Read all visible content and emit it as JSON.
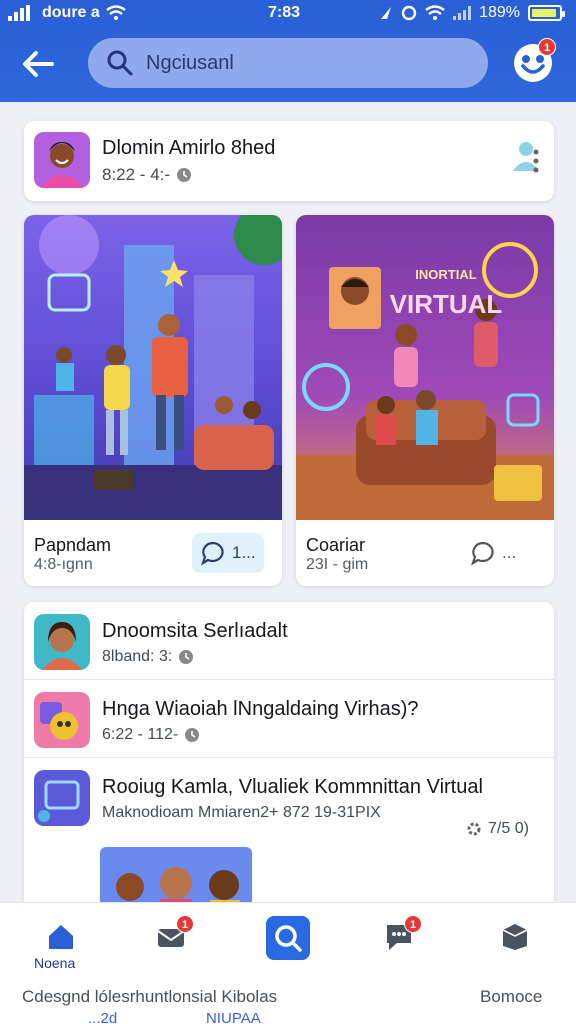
{
  "status_bar": {
    "carrier": "doure a",
    "time": "7:83",
    "battery_pct": "189%",
    "battery_fill": 0.8,
    "battery_color": "#e4f36a"
  },
  "header": {
    "bg_color": "#2f67dc",
    "back_icon": "back-arrow-icon",
    "search": {
      "placeholder": "Ngciusanl",
      "icon": "search-icon"
    },
    "profile_badge": "1"
  },
  "post_head": {
    "name": "Dlomin Amirlo 8hed",
    "meta": "8:22 - 4:-",
    "icons": [
      "person-icon",
      "more-vertical-icon"
    ]
  },
  "media_cards": [
    {
      "title": "Papndam",
      "subtitle": "4:8-ıgnn",
      "comments": "1..."
    },
    {
      "title": "Coariar",
      "subtitle": "23I - gim",
      "comments": "..."
    }
  ],
  "overlay_text": {
    "line1": "INORTIAL",
    "line2": "VIRTUAL"
  },
  "list_items": [
    {
      "title": "Dnoomsita Serlıadalt",
      "sub": "8lband: 3:"
    },
    {
      "title": "Hnga Wiaoiah lNngaldaing Virhas)?",
      "sub": "6:22 - 112-"
    },
    {
      "title": "Rooiug Kamla, Vlualiek Kommnittan Virtual",
      "sub": "Maknodioam Mmiaren2+ 872 19-31PIX"
    }
  ],
  "list_extra": "7/5 0)",
  "bottom_nav": {
    "items": [
      {
        "label": "Noenа",
        "icon": "home-icon",
        "badge": ""
      },
      {
        "label": "",
        "icon": "mail-icon",
        "badge": "1"
      },
      {
        "label": "",
        "icon": "search-icon",
        "badge": ""
      },
      {
        "label": "",
        "icon": "chat-icon",
        "badge": "1"
      },
      {
        "label": "",
        "icon": "inbox-icon",
        "badge": ""
      }
    ],
    "footer_left": "Cdesgnd lólesrhuntlonsial Kibolas",
    "footer_right": "Bomoce",
    "cut_left": "...2d",
    "cut_mid": "NIUPAA"
  }
}
